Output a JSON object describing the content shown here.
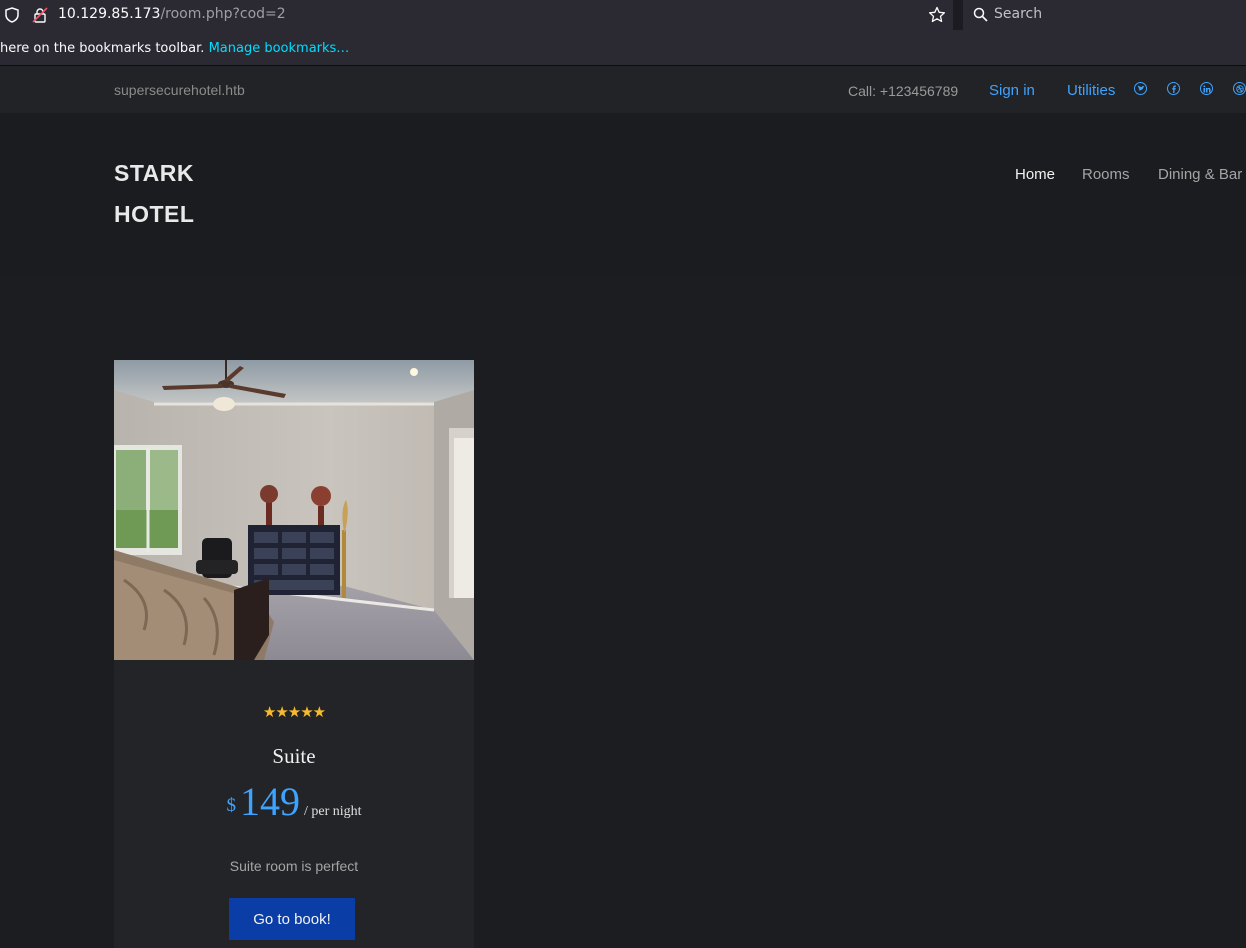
{
  "browser": {
    "url_host": "10.129.85.173",
    "url_path": "/room.php?cod=2",
    "search_placeholder": "Search",
    "bookmarks_text": "here on the bookmarks toolbar.",
    "bookmarks_link": "Manage bookmarks…"
  },
  "topbar": {
    "domain": "supersecurehotel.htb",
    "call": "Call: +123456789",
    "signin": "Sign in",
    "utilities": "Utilities",
    "social_icons": [
      "twitter-icon",
      "facebook-icon",
      "linkedin-icon",
      "dribbble-icon"
    ]
  },
  "header": {
    "logo_line1": "STARK",
    "logo_line2": "HOTEL",
    "nav": [
      {
        "label": "Home",
        "active": true
      },
      {
        "label": "Rooms",
        "active": false
      },
      {
        "label": "Dining & Bar",
        "active": false
      }
    ]
  },
  "room": {
    "stars": "★★★★★",
    "rating": 5,
    "name": "Suite",
    "currency": "$",
    "price": "149",
    "per": "/ per night",
    "description": "Suite room is perfect",
    "book_label": "Go to book!"
  },
  "colors": {
    "accent": "#3ea3ff",
    "button": "#0a3ea6",
    "stars": "#f7b92f",
    "background": "#1c1d20"
  }
}
